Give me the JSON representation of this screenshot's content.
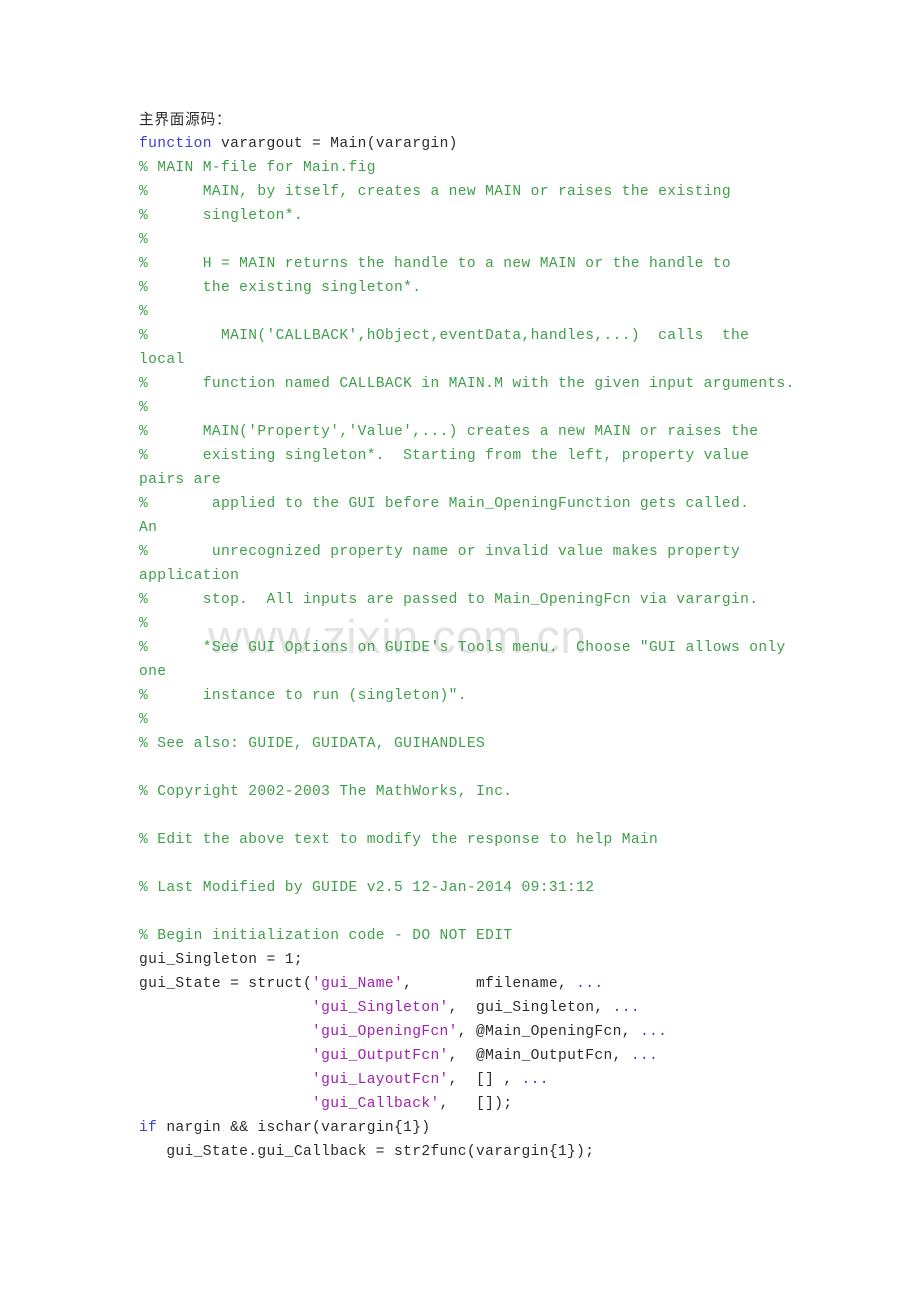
{
  "document": {
    "page_background": "#ffffff",
    "watermark": "www.zixin.com.cn",
    "watermark_color": "#e3e3e3",
    "colors": {
      "comment_green": "#3f9f4a",
      "keyword_blue": "#3f3fd0",
      "string_magenta": "#a020b0",
      "plain_text": "#2b2b2b"
    },
    "heading": "主界面源码："
  },
  "code": {
    "language": "MATLAB",
    "lines": [
      {
        "i": 0,
        "kind": "heading",
        "text": "主界面源码："
      },
      {
        "i": 1,
        "kind": "code",
        "text": "function varargout = Main(varargin)"
      },
      {
        "i": 2,
        "kind": "comment",
        "text": "% MAIN M-file for Main.fig"
      },
      {
        "i": 3,
        "kind": "comment",
        "text": "%      MAIN, by itself, creates a new MAIN or raises the existing"
      },
      {
        "i": 4,
        "kind": "comment",
        "text": "%      singleton*."
      },
      {
        "i": 5,
        "kind": "comment",
        "text": "%"
      },
      {
        "i": 6,
        "kind": "comment",
        "text": "%      H = MAIN returns the handle to a new MAIN or the handle to"
      },
      {
        "i": 7,
        "kind": "comment",
        "text": "%      the existing singleton*."
      },
      {
        "i": 8,
        "kind": "comment",
        "text": "%"
      },
      {
        "i": 9,
        "kind": "comment",
        "text": "%        MAIN('CALLBACK',hObject,eventData,handles,...)  calls  the"
      },
      {
        "i": 10,
        "kind": "comment",
        "text": "local"
      },
      {
        "i": 11,
        "kind": "comment",
        "text": "%      function named CALLBACK in MAIN.M with the given input arguments."
      },
      {
        "i": 12,
        "kind": "comment",
        "text": "%"
      },
      {
        "i": 13,
        "kind": "comment",
        "text": "%      MAIN('Property','Value',...) creates a new MAIN or raises the"
      },
      {
        "i": 14,
        "kind": "comment",
        "text": "%      existing singleton*.  Starting from the left, property value"
      },
      {
        "i": 15,
        "kind": "comment",
        "text": "pairs are"
      },
      {
        "i": 16,
        "kind": "comment",
        "text": "%       applied to the GUI before Main_OpeningFunction gets called."
      },
      {
        "i": 17,
        "kind": "comment",
        "text": "An"
      },
      {
        "i": 18,
        "kind": "comment",
        "text": "%       unrecognized property name or invalid value makes property"
      },
      {
        "i": 19,
        "kind": "comment",
        "text": "application"
      },
      {
        "i": 20,
        "kind": "comment",
        "text": "%      stop.  All inputs are passed to Main_OpeningFcn via varargin."
      },
      {
        "i": 21,
        "kind": "comment",
        "text": "%"
      },
      {
        "i": 22,
        "kind": "comment",
        "text": "%      *See GUI Options on GUIDE's Tools menu.  Choose \"GUI allows only"
      },
      {
        "i": 23,
        "kind": "comment",
        "text": "one"
      },
      {
        "i": 24,
        "kind": "comment",
        "text": "%      instance to run (singleton)\"."
      },
      {
        "i": 25,
        "kind": "comment",
        "text": "%"
      },
      {
        "i": 26,
        "kind": "comment",
        "text": "% See also: GUIDE, GUIDATA, GUIHANDLES"
      },
      {
        "i": 27,
        "kind": "blank",
        "text": ""
      },
      {
        "i": 28,
        "kind": "comment",
        "text": "% Copyright 2002-2003 The MathWorks, Inc."
      },
      {
        "i": 29,
        "kind": "blank",
        "text": ""
      },
      {
        "i": 30,
        "kind": "comment",
        "text": "% Edit the above text to modify the response to help Main"
      },
      {
        "i": 31,
        "kind": "blank",
        "text": ""
      },
      {
        "i": 32,
        "kind": "comment",
        "text": "% Last Modified by GUIDE v2.5 12-Jan-2014 09:31:12"
      },
      {
        "i": 33,
        "kind": "blank",
        "text": ""
      },
      {
        "i": 34,
        "kind": "comment",
        "text": "% Begin initialization code - DO NOT EDIT"
      },
      {
        "i": 35,
        "kind": "code",
        "text": "gui_Singleton = 1;"
      },
      {
        "i": 36,
        "kind": "code",
        "text": "gui_State = struct('gui_Name',       mfilename, ..."
      },
      {
        "i": 37,
        "kind": "code",
        "text": "                   'gui_Singleton',  gui_Singleton, ..."
      },
      {
        "i": 38,
        "kind": "code",
        "text": "                   'gui_OpeningFcn', @Main_OpeningFcn, ..."
      },
      {
        "i": 39,
        "kind": "code",
        "text": "                   'gui_OutputFcn',  @Main_OutputFcn, ..."
      },
      {
        "i": 40,
        "kind": "code",
        "text": "                   'gui_LayoutFcn',  [] , ..."
      },
      {
        "i": 41,
        "kind": "code",
        "text": "                   'gui_Callback',   []);"
      },
      {
        "i": 42,
        "kind": "code",
        "text": "if nargin && ischar(varargin{1})"
      },
      {
        "i": 43,
        "kind": "code",
        "text": "   gui_State.gui_Callback = str2func(varargin{1});"
      }
    ],
    "segments": [
      [
        {
          "t": "主界面源码：",
          "c": "cn"
        }
      ],
      [
        {
          "t": "function",
          "c": "kw"
        },
        {
          "t": " varargout = Main(varargin)",
          "c": "pl"
        }
      ],
      [
        {
          "t": "% MAIN M-file for Main.fig",
          "c": "cm"
        }
      ],
      [
        {
          "t": "%      MAIN, by itself, creates a new MAIN or raises the existing",
          "c": "cm"
        }
      ],
      [
        {
          "t": "%      singleton*.",
          "c": "cm"
        }
      ],
      [
        {
          "t": "%",
          "c": "cm"
        }
      ],
      [
        {
          "t": "%      H = MAIN returns the handle to a new MAIN or the handle to",
          "c": "cm"
        }
      ],
      [
        {
          "t": "%      the existing singleton*.",
          "c": "cm"
        }
      ],
      [
        {
          "t": "%",
          "c": "cm"
        }
      ],
      [
        {
          "t": "%        MAIN('CALLBACK',hObject,eventData,handles,...)  calls  the",
          "c": "cm"
        }
      ],
      [
        {
          "t": "local",
          "c": "cm"
        }
      ],
      [
        {
          "t": "%      function named CALLBACK in MAIN.M with the given input arguments.",
          "c": "cm"
        }
      ],
      [
        {
          "t": "%",
          "c": "cm"
        }
      ],
      [
        {
          "t": "%      MAIN('Property','Value',...) creates a new MAIN or raises the",
          "c": "cm"
        }
      ],
      [
        {
          "t": "%      existing singleton*.  Starting from the left, property value",
          "c": "cm"
        }
      ],
      [
        {
          "t": "pairs are",
          "c": "cm"
        }
      ],
      [
        {
          "t": "%       applied to the GUI before Main_OpeningFunction gets called.",
          "c": "cm"
        }
      ],
      [
        {
          "t": "An",
          "c": "cm"
        }
      ],
      [
        {
          "t": "%       unrecognized property name or invalid value makes property",
          "c": "cm"
        }
      ],
      [
        {
          "t": "application",
          "c": "cm"
        }
      ],
      [
        {
          "t": "%      stop.  All inputs are passed to Main_OpeningFcn via varargin.",
          "c": "cm"
        }
      ],
      [
        {
          "t": "%",
          "c": "cm"
        }
      ],
      [
        {
          "t": "%      *See GUI Options on GUIDE's Tools menu.  Choose \"GUI allows only",
          "c": "cm"
        }
      ],
      [
        {
          "t": "one",
          "c": "cm"
        }
      ],
      [
        {
          "t": "%      instance to run (singleton)\".",
          "c": "cm"
        }
      ],
      [
        {
          "t": "%",
          "c": "cm"
        }
      ],
      [
        {
          "t": "% See also: GUIDE, GUIDATA, GUIHANDLES",
          "c": "cm"
        }
      ],
      [
        {
          "t": "",
          "c": "pl"
        }
      ],
      [
        {
          "t": "% Copyright 2002-2003 The MathWorks, Inc.",
          "c": "cm"
        }
      ],
      [
        {
          "t": "",
          "c": "pl"
        }
      ],
      [
        {
          "t": "% Edit the above text to modify the response to help Main",
          "c": "cm"
        }
      ],
      [
        {
          "t": "",
          "c": "pl"
        }
      ],
      [
        {
          "t": "% Last Modified by GUIDE v2.5 12-Jan-2014 09:31:12",
          "c": "cm"
        }
      ],
      [
        {
          "t": "",
          "c": "pl"
        }
      ],
      [
        {
          "t": "% Begin initialization code - DO NOT EDIT",
          "c": "cm"
        }
      ],
      [
        {
          "t": "gui_Singleton = 1;",
          "c": "pl"
        }
      ],
      [
        {
          "t": "gui_State = struct(",
          "c": "pl"
        },
        {
          "t": "'gui_Name'",
          "c": "str"
        },
        {
          "t": ",       mfilename, ",
          "c": "pl"
        },
        {
          "t": "...",
          "c": "ell"
        }
      ],
      [
        {
          "t": "                   ",
          "c": "pl"
        },
        {
          "t": "'gui_Singleton'",
          "c": "str"
        },
        {
          "t": ",  gui_Singleton, ",
          "c": "pl"
        },
        {
          "t": "...",
          "c": "ell"
        }
      ],
      [
        {
          "t": "                   ",
          "c": "pl"
        },
        {
          "t": "'gui_OpeningFcn'",
          "c": "str"
        },
        {
          "t": ", @Main_OpeningFcn, ",
          "c": "pl"
        },
        {
          "t": "...",
          "c": "ell"
        }
      ],
      [
        {
          "t": "                   ",
          "c": "pl"
        },
        {
          "t": "'gui_OutputFcn'",
          "c": "str"
        },
        {
          "t": ",  @Main_OutputFcn, ",
          "c": "pl"
        },
        {
          "t": "...",
          "c": "ell"
        }
      ],
      [
        {
          "t": "                   ",
          "c": "pl"
        },
        {
          "t": "'gui_LayoutFcn'",
          "c": "str"
        },
        {
          "t": ",  [] , ",
          "c": "pl"
        },
        {
          "t": "...",
          "c": "ell"
        }
      ],
      [
        {
          "t": "                   ",
          "c": "pl"
        },
        {
          "t": "'gui_Callback'",
          "c": "str"
        },
        {
          "t": ",   []);",
          "c": "pl"
        }
      ],
      [
        {
          "t": "if",
          "c": "kw"
        },
        {
          "t": " nargin && ischar(varargin{1})",
          "c": "pl"
        }
      ],
      [
        {
          "t": "   gui_State.gui_Callback = str2func(varargin{1});",
          "c": "pl"
        }
      ]
    ]
  }
}
